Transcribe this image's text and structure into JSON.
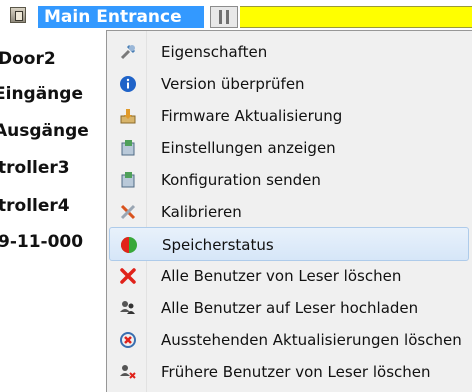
{
  "tree": {
    "selected_node": "Main Entrance",
    "items": [
      "Door2",
      "Eingänge",
      "Ausgänge",
      "troller3",
      "troller4",
      "9-11-000"
    ]
  },
  "context_menu": {
    "items": [
      {
        "label": "Eigenschaften",
        "icon": "tools-icon"
      },
      {
        "label": "Version überprüfen",
        "icon": "info-icon"
      },
      {
        "label": "Firmware Aktualisierung",
        "icon": "firmware-icon"
      },
      {
        "label": "Einstellungen anzeigen",
        "icon": "settings-display-icon"
      },
      {
        "label": "Konfiguration senden",
        "icon": "send-config-icon"
      },
      {
        "label": "Kalibrieren",
        "icon": "calibrate-icon"
      },
      {
        "label": "Speicherstatus",
        "icon": "memory-status-icon"
      },
      {
        "label": "Alle Benutzer von Leser löschen",
        "icon": "delete-icon"
      },
      {
        "label": "Alle Benutzer auf Leser hochladen",
        "icon": "users-upload-icon"
      },
      {
        "label": "Ausstehenden Aktualisierungen löschen",
        "icon": "cancel-updates-icon"
      },
      {
        "label": "Frühere Benutzer von Leser löschen",
        "icon": "users-delete-icon"
      }
    ],
    "highlighted_item": "Speicherstatus"
  }
}
